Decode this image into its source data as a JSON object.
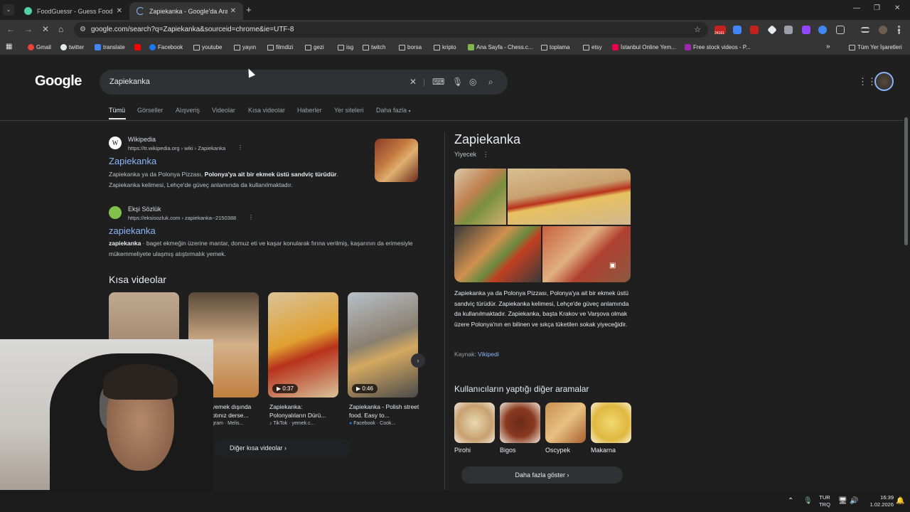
{
  "browser": {
    "tabs": [
      {
        "title": "FoodGuessr - Guess Food from",
        "favicon_color": "#4fd1a5"
      },
      {
        "title": "Zapiekanka - Google'da Ara",
        "favicon_color": "#8ab4f8"
      }
    ],
    "url": "google.com/search?q=Zapiekanka&sourceid=chrome&ie=UTF-8",
    "extension_badge": "24161",
    "bookmarks": [
      "Gmail",
      "twitter",
      "translate",
      "Facebook",
      "youtube",
      "yayın",
      "filmdizi",
      "gezi",
      "isg",
      "twitch",
      "borsa",
      "kripto",
      "Ana Sayfa - Chess.c...",
      "toplama",
      "etsy",
      "İstanbul Online Yem...",
      "Free stock videos - P..."
    ],
    "all_bookmarks": "Tüm Yer İşaretleri"
  },
  "google": {
    "logo": "Google",
    "query": "Zapiekanka",
    "tabs": [
      "Tümü",
      "Görseller",
      "Alışveriş",
      "Videolar",
      "Kısa videolar",
      "Haberler",
      "Yer siteleri",
      "Daha fazla"
    ],
    "results": [
      {
        "site": "Wikipedia",
        "url": "https://tr.wikipedia.org › wiki › Zapiekanka",
        "title": "Zapiekanka",
        "snippet_pre": "Zapiekanka ya da Polonya Pizzası, ",
        "snippet_bold": "Polonya'ya ait bir ekmek üstü sandviç türüdür",
        "snippet_post": ". Zapiekanka kelimesi, Lehçe'de güveç anlamında da kullanılmaktadır."
      },
      {
        "site": "Ekşi Sözlük",
        "url": "https://eksisozluk.com › zapiekanka--2150388",
        "title": "zapiekanka",
        "snippet_bold": "zapiekanka",
        "snippet_post": " · baget ekmeğin üzerine mantar, domuz eti ve kaşar konularak fırına verilmiş, kaşarının da erimesiyle mükemmeliyete ulaşmış atıştırmalık yemek."
      }
    ],
    "short_videos_heading": "Kısa videolar",
    "videos": [
      {
        "caption": "",
        "source": "",
        "duration": ""
      },
      {
        "caption": "yemek dışında ptınız derse...",
        "source": "gram · Melis...",
        "duration": ""
      },
      {
        "caption": "Zapiekanka: Polonyalıların Dürü...",
        "source": "TikTok · yemek.c...",
        "duration": "0:37"
      },
      {
        "caption": "Zapiekanka - Polish street food. Easy to...",
        "source": "Facebook · Cook...",
        "duration": "0:46"
      }
    ],
    "more_videos": "Diğer kısa videolar",
    "knowledge_panel": {
      "title": "Zapiekanka",
      "subtitle": "Yiyecek",
      "description": "Zapiekanka ya da Polonya Pizzası, Polonya'ya ait bir ekmek üstü sandviç türüdür. Zapiekanka kelimesi, Lehçe'de güveç anlamında da kullanılmaktadır. Zapiekanka, başta Krakov ve Varşova olmak üzere Polonya'nın en bilinen ve sıkça tüketilen sokak yiyeceğidir.",
      "source_label": "Kaynak:",
      "source_link": "Vikipedi",
      "related_heading": "Kullanıcıların yaptığı diğer aramalar",
      "related": [
        "Pirohi",
        "Bigos",
        "Oscypek",
        "Makarna"
      ],
      "show_more": "Daha fazla göster"
    }
  },
  "taskbar": {
    "lang_top": "TUR",
    "lang_bottom": "TRQ",
    "time": "16:39",
    "date": "1.02.2026"
  }
}
